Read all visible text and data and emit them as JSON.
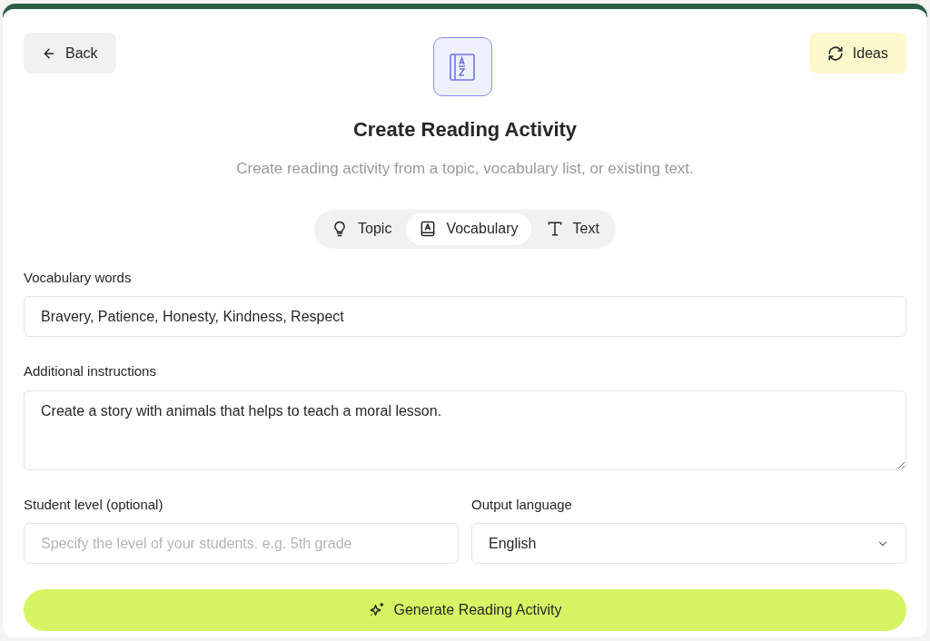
{
  "header": {
    "back_button": "Back",
    "ideas_button": "Ideas"
  },
  "title": "Create Reading Activity",
  "subtitle": "Create reading activity from a topic, vocabulary list, or existing text.",
  "tabs": [
    {
      "label": "Topic",
      "selected": false
    },
    {
      "label": "Vocabulary",
      "selected": true
    },
    {
      "label": "Text",
      "selected": false
    }
  ],
  "vocabulary": {
    "label": "Vocabulary words",
    "value": "Bravery, Patience, Honesty, Kindness, Respect"
  },
  "instructions": {
    "label": "Additional instructions",
    "value": "Create a story with animals that helps to teach a moral lesson."
  },
  "student_level": {
    "label": "Student level (optional)",
    "placeholder": "Specify the level of your students. e.g. 5th grade"
  },
  "output_language": {
    "label": "Output language",
    "value": "English"
  },
  "generate_button": "Generate Reading Activity"
}
